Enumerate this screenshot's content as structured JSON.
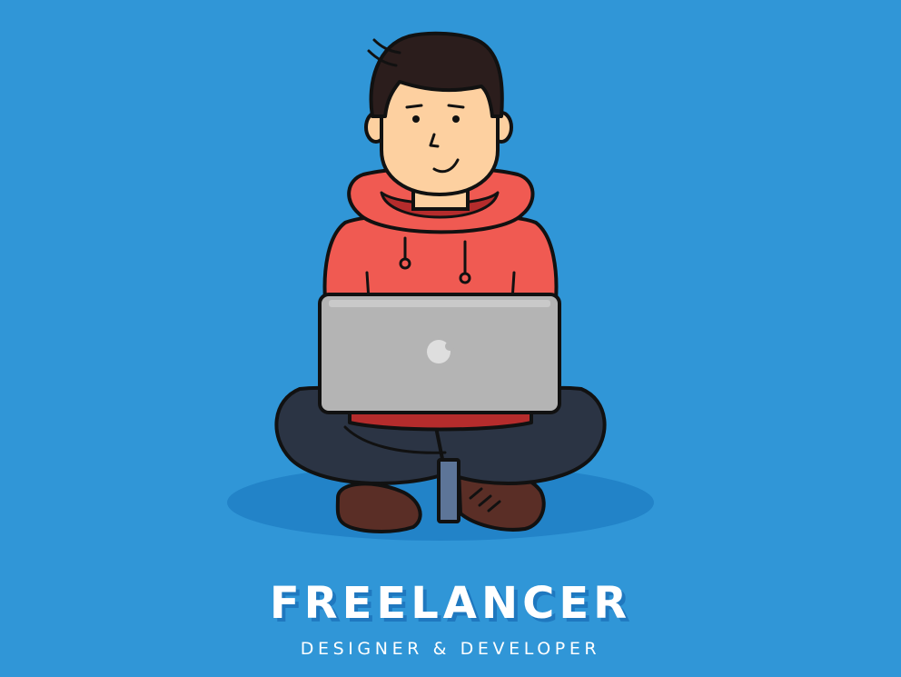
{
  "title": "FREELANCER",
  "subtitle": "DESIGNER & DEVELOPER",
  "colors": {
    "background": "#3096d7",
    "ground_shadow": "#2283c8",
    "skin": "#fdd0a0",
    "hair": "#2b1d1c",
    "hoodie": "#f05a52",
    "hoodie_inner": "#b52c2c",
    "pants": "#2b3444",
    "laptop": "#b4b4b4",
    "shoe": "#5a2e26",
    "sock": "#5d7598",
    "outline": "#111111",
    "text": "#ffffff"
  },
  "icons": {
    "laptop_logo": "apple-logo-icon"
  }
}
